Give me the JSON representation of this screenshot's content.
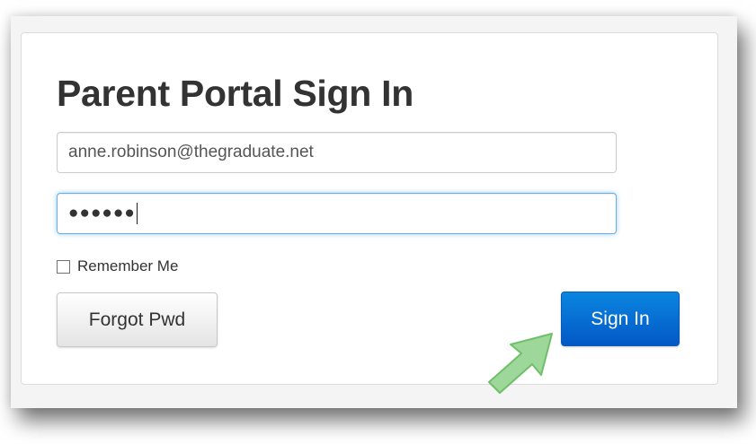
{
  "title": "Parent Portal Sign In",
  "email": {
    "value": "anne.robinson@thegraduate.net"
  },
  "password": {
    "masked_value": "●●●●●●"
  },
  "remember_me": {
    "label": "Remember Me",
    "checked": false
  },
  "buttons": {
    "forgot_label": "Forgot Pwd",
    "signin_label": "Sign In"
  },
  "annotation": {
    "icon": "green-arrow-icon",
    "color": "#9dd89a"
  },
  "colors": {
    "primary": "#0358c6",
    "focus": "#66afe9"
  }
}
